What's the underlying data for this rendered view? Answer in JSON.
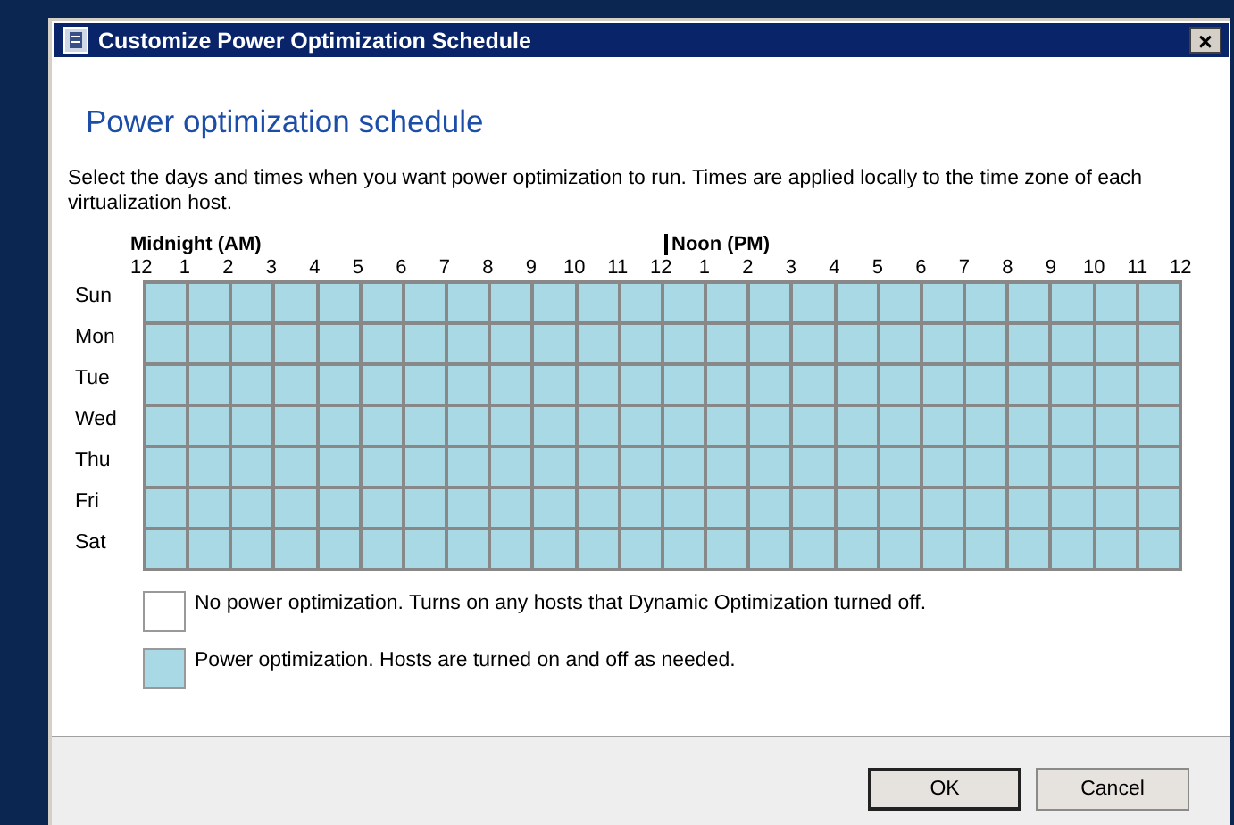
{
  "window": {
    "title": "Customize Power Optimization Schedule",
    "close": "×"
  },
  "heading": "Power optimization schedule",
  "description": "Select the days and times when you want power optimization to run. Times are applied locally to the time zone of each virtualization host.",
  "schedule": {
    "am_label": "Midnight (AM)",
    "pm_label": "Noon (PM)",
    "hours": [
      "12",
      "1",
      "2",
      "3",
      "4",
      "5",
      "6",
      "7",
      "8",
      "9",
      "10",
      "11",
      "12",
      "1",
      "2",
      "3",
      "4",
      "5",
      "6",
      "7",
      "8",
      "9",
      "10",
      "11",
      "12"
    ],
    "days": [
      {
        "label": "Sun",
        "slots": [
          true,
          true,
          true,
          true,
          true,
          true,
          true,
          true,
          true,
          true,
          true,
          true,
          true,
          true,
          true,
          true,
          true,
          true,
          true,
          true,
          true,
          true,
          true,
          true
        ]
      },
      {
        "label": "Mon",
        "slots": [
          true,
          true,
          true,
          true,
          true,
          true,
          true,
          true,
          true,
          true,
          true,
          true,
          true,
          true,
          true,
          true,
          true,
          true,
          true,
          true,
          true,
          true,
          true,
          true
        ]
      },
      {
        "label": "Tue",
        "slots": [
          true,
          true,
          true,
          true,
          true,
          true,
          true,
          true,
          true,
          true,
          true,
          true,
          true,
          true,
          true,
          true,
          true,
          true,
          true,
          true,
          true,
          true,
          true,
          true
        ]
      },
      {
        "label": "Wed",
        "slots": [
          true,
          true,
          true,
          true,
          true,
          true,
          true,
          true,
          true,
          true,
          true,
          true,
          true,
          true,
          true,
          true,
          true,
          true,
          true,
          true,
          true,
          true,
          true,
          true
        ]
      },
      {
        "label": "Thu",
        "slots": [
          true,
          true,
          true,
          true,
          true,
          true,
          true,
          true,
          true,
          true,
          true,
          true,
          true,
          true,
          true,
          true,
          true,
          true,
          true,
          true,
          true,
          true,
          true,
          true
        ]
      },
      {
        "label": "Fri",
        "slots": [
          true,
          true,
          true,
          true,
          true,
          true,
          true,
          true,
          true,
          true,
          true,
          true,
          true,
          true,
          true,
          true,
          true,
          true,
          true,
          true,
          true,
          true,
          true,
          true
        ]
      },
      {
        "label": "Sat",
        "slots": [
          true,
          true,
          true,
          true,
          true,
          true,
          true,
          true,
          true,
          true,
          true,
          true,
          true,
          true,
          true,
          true,
          true,
          true,
          true,
          true,
          true,
          true,
          true,
          true
        ]
      }
    ]
  },
  "legend": [
    {
      "kind": "off",
      "text": "No power optimization. Turns on any hosts that Dynamic Optimization turned off."
    },
    {
      "kind": "on",
      "text": "Power optimization. Hosts are turned on and off as needed."
    }
  ],
  "buttons": [
    {
      "label": "OK",
      "default": true
    },
    {
      "label": "Cancel",
      "default": false
    }
  ]
}
